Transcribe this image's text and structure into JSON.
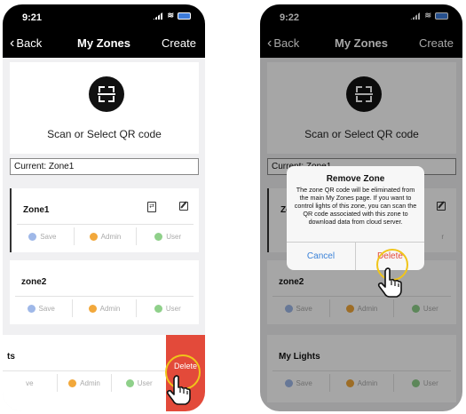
{
  "screen1": {
    "status": {
      "time": "9:21"
    },
    "nav": {
      "back": "Back",
      "title": "My Zones",
      "right": "Create"
    },
    "scan": {
      "label": "Scan or Select QR code"
    },
    "current": "Current:  Zone1",
    "zones": [
      {
        "name": "Zone1",
        "save": "Save",
        "admin": "Admin",
        "user": "User"
      },
      {
        "name": "zone2",
        "save": "Save",
        "admin": "Admin",
        "user": "User"
      },
      {
        "name": "ts",
        "save": "ve",
        "admin": "Admin",
        "user": "User",
        "delete": "Delete"
      }
    ]
  },
  "screen2": {
    "status": {
      "time": "9:22"
    },
    "nav": {
      "back": "Back",
      "title": "My Zones",
      "right": "Create"
    },
    "scan": {
      "label": "Scan or Select QR code"
    },
    "current": "Current:  Zone1",
    "zones": [
      {
        "name": "Zon",
        "save": "",
        "admin": "",
        "user": "r"
      },
      {
        "name": "zone2",
        "save": "Save",
        "admin": "Admin",
        "user": "User"
      },
      {
        "name": "My Lights",
        "save": "Save",
        "admin": "Admin",
        "user": "User"
      }
    ],
    "dialog": {
      "title": "Remove Zone",
      "message": "The zone QR code will be eliminated from the main My Zones page. If you want to control lights of this zone, you can scan the QR code associated with this zone to download data from cloud server.",
      "cancel": "Cancel",
      "delete": "Delete"
    }
  },
  "colors": {
    "accent_blue": "#3b82d8",
    "delete_red": "#e34a3a",
    "highlight": "#f0c51a"
  }
}
